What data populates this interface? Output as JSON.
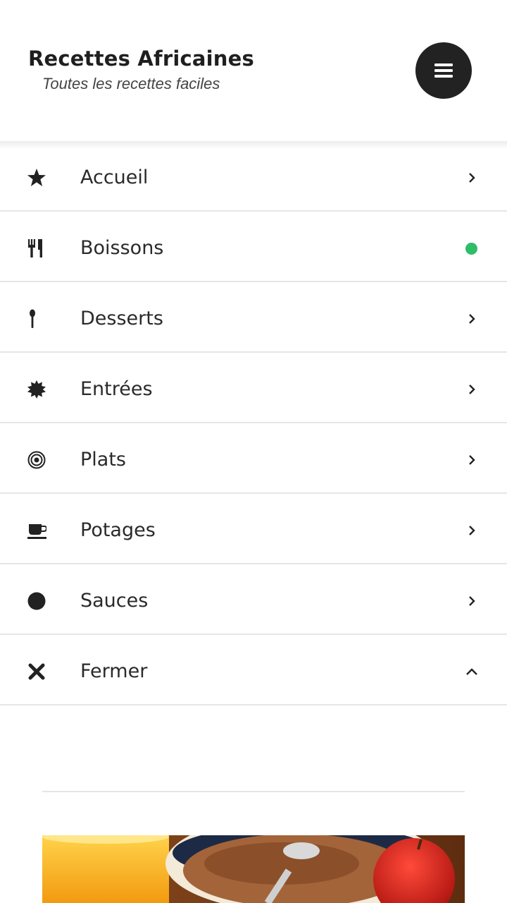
{
  "header": {
    "title": "Recettes Africaines",
    "subtitle": "Toutes les recettes faciles",
    "menu_icon": "hamburger-icon"
  },
  "nav": {
    "items": [
      {
        "label": "Accueil",
        "icon": "star-icon",
        "indicator": "chevron-right"
      },
      {
        "label": "Boissons",
        "icon": "cutlery-icon",
        "indicator": "active-dot"
      },
      {
        "label": "Desserts",
        "icon": "spoon-icon",
        "indicator": "chevron-right"
      },
      {
        "label": "Entrées",
        "icon": "burst-icon",
        "indicator": "chevron-right"
      },
      {
        "label": "Plats",
        "icon": "target-icon",
        "indicator": "chevron-right"
      },
      {
        "label": "Potages",
        "icon": "cup-icon",
        "indicator": "chevron-right"
      },
      {
        "label": "Sauces",
        "icon": "circle-icon",
        "indicator": "chevron-right"
      },
      {
        "label": "Fermer",
        "icon": "close-icon",
        "indicator": "chevron-up"
      }
    ]
  },
  "colors": {
    "active_dot": "#2ebd68",
    "menu_button_bg": "#222222",
    "divider": "#e6e6e6"
  },
  "photo": {
    "subject": "breakfast-photo"
  }
}
